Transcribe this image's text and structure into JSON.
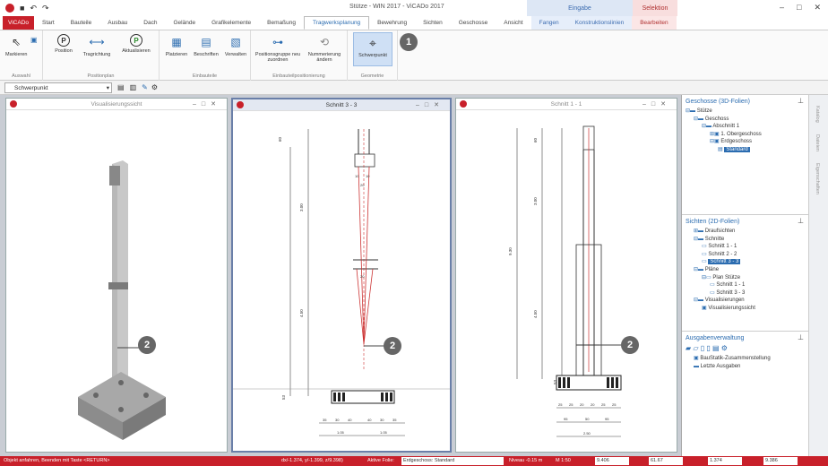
{
  "app": {
    "title": "Stütze - WIN 2017 - ViCADo 2017"
  },
  "context_tabs": {
    "eingabe": "Eingabe",
    "selektion": "Selektion"
  },
  "tabs": [
    "ViCADo",
    "Start",
    "Bauteile",
    "Ausbau",
    "Dach",
    "Gelände",
    "Grafikelemente",
    "Bemaßung",
    "Tragwerksplanung",
    "Bewehrung",
    "Sichten",
    "Geschosse",
    "Ansicht",
    "Fangen",
    "Konstruktionslinien",
    "Bearbeiten"
  ],
  "active_tab": "Tragwerksplanung",
  "ribbon": {
    "auswahl": {
      "label": "Auswahl",
      "buttons": [
        "Markieren"
      ]
    },
    "positionplan": {
      "label": "Positionplan",
      "buttons": [
        "Position",
        "Tragrichtung",
        "Aktualisieren"
      ]
    },
    "einbauteile": {
      "label": "Einbauteile",
      "buttons": [
        "Platzieren",
        "Beschriften",
        "Verwalten"
      ]
    },
    "positionierung": {
      "label": "Einbauteilpositionierung",
      "buttons": [
        "Positionsgruppe neu zuordnen",
        "Nummerierung ändern"
      ]
    },
    "geometrie": {
      "label": "Geometrie",
      "buttons": [
        "Schwerpunkt"
      ]
    }
  },
  "toolbar": {
    "layer_combo": "Schwerpunkt"
  },
  "panels": {
    "p1": "Visualisierungssicht",
    "p2": "Schnitt 3 - 3",
    "p3": "Schnitt 1 - 1"
  },
  "side": {
    "geschosse": {
      "title": "Geschosse (3D-Folien)",
      "items": [
        "Stütze",
        "Geschoss",
        "Abschnitt 1",
        "1. Obergeschoss",
        "Erdgeschoss",
        "Standard"
      ]
    },
    "sichten": {
      "title": "Sichten (2D-Folien)",
      "items": [
        "Draufsichten",
        "Schnitte",
        "Schnitt 1 - 1",
        "Schnitt 2 - 2",
        "Schnitt 3 - 3",
        "Pläne",
        "Plan Stütze",
        "Schnitt 1 - 1",
        "Schnitt 3 - 3",
        "Visualisierungen",
        "Visualisierungssicht"
      ]
    },
    "ausgaben": {
      "title": "Ausgabenverwaltung",
      "items": [
        "BauStatik-Zusammenstellung",
        "Letzte Ausgaben"
      ]
    }
  },
  "vtabs": [
    "Katalog",
    "Dateien",
    "Eigenschaften"
  ],
  "drawing": {
    "p2": {
      "dims_left": [
        "60",
        "3.00",
        "4.50",
        "53"
      ],
      "top_dims": [
        "10",
        "10",
        "20"
      ],
      "mid_dim": "20",
      "bottom_dims": [
        "35",
        "30",
        "40",
        "40",
        "30",
        "35"
      ],
      "bottom_totals": [
        "1.05",
        "1.05"
      ]
    },
    "p3": {
      "dims_left": [
        "9.30",
        "60",
        "3.00",
        "4.50",
        "53"
      ],
      "bottom_dims": [
        "25",
        "25",
        "20",
        "20",
        "25",
        "25"
      ],
      "bottom_mid": [
        "95",
        "50",
        "95"
      ],
      "bottom_total": "2.50"
    }
  },
  "callouts": [
    "1",
    "2",
    "2",
    "2"
  ],
  "status": {
    "msg": "Objekt anfahren, Beenden mit Taste <RETURN>",
    "coords": "dx/-1.374, y/-1.399, z/9.398)",
    "active_label": "Aktive Folie:",
    "active_value": "Erdgeschoss: Standard",
    "niveau": "Niveau -0.15 m",
    "scale": "M 1:50",
    "dx": "9.406",
    "dy": "61.67",
    "x": "1.374",
    "y": "9.386"
  }
}
